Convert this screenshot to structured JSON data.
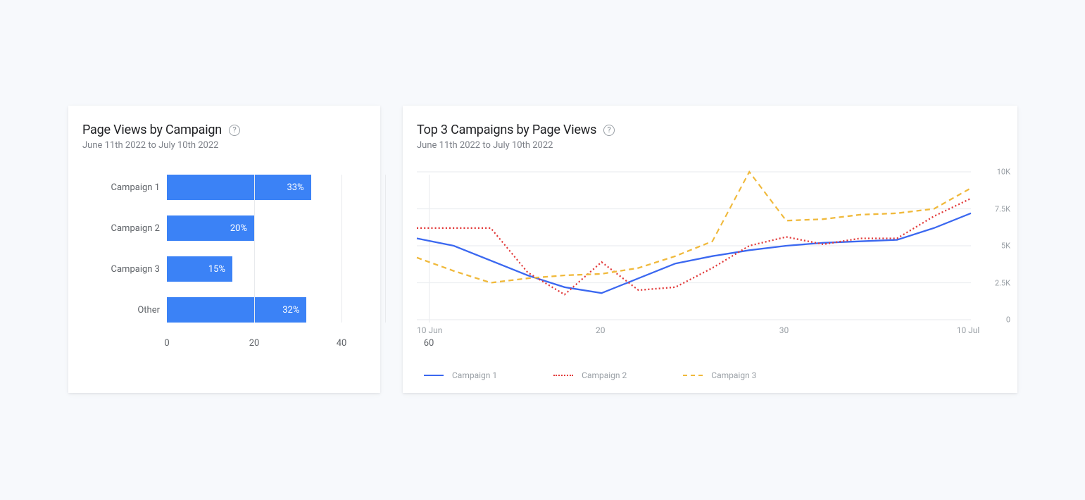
{
  "chart_data": [
    {
      "type": "bar",
      "title": "Page Views by Campaign",
      "subtitle": "June 11th 2022 to July 10th 2022",
      "orientation": "horizontal",
      "categories": [
        "Campaign 1",
        "Campaign 2",
        "Campaign 3",
        "Other"
      ],
      "values": [
        33,
        20,
        15,
        32
      ],
      "value_suffix": "%",
      "xlabel": "",
      "ylabel": "",
      "xlim": [
        0,
        60
      ],
      "x_ticks": [
        0,
        20,
        40,
        60
      ],
      "bar_color": "#3b82f6"
    },
    {
      "type": "line",
      "title": "Top 3 Campaigns by Page Views",
      "subtitle": "June 11th 2022 to July 10th 2022",
      "x": [
        10,
        12,
        14,
        16,
        18,
        20,
        22,
        24,
        26,
        28,
        30,
        2,
        4,
        6,
        8,
        10
      ],
      "x_tick_labels": [
        "10 Jun",
        "20",
        "30",
        "10 Jul"
      ],
      "x_tick_positions": [
        10,
        20,
        30,
        40
      ],
      "ylim": [
        0,
        10000
      ],
      "y_ticks": [
        0,
        2500,
        5000,
        7500,
        10000
      ],
      "y_tick_labels": [
        "0",
        "2.5K",
        "5K",
        "7.5K",
        "10K"
      ],
      "series": [
        {
          "name": "Campaign 1",
          "color": "#3b68f0",
          "dash": "solid",
          "values": [
            5500,
            5000,
            4000,
            3000,
            2200,
            1800,
            2800,
            3800,
            4300,
            4700,
            5000,
            5200,
            5300,
            5400,
            6200,
            7200
          ]
        },
        {
          "name": "Campaign 2",
          "color": "#e23b3b",
          "dash": "dotted",
          "values": [
            6200,
            6200,
            6200,
            3200,
            1700,
            3900,
            2000,
            2200,
            3500,
            5000,
            5600,
            5100,
            5500,
            5500,
            7000,
            8200
          ]
        },
        {
          "name": "Campaign 3",
          "color": "#f0b93b",
          "dash": "dashed",
          "values": [
            4200,
            3300,
            2500,
            2800,
            3000,
            3100,
            3500,
            4300,
            5300,
            10000,
            6700,
            6800,
            7100,
            7200,
            7500,
            8900
          ]
        }
      ],
      "legend_position": "bottom"
    }
  ]
}
